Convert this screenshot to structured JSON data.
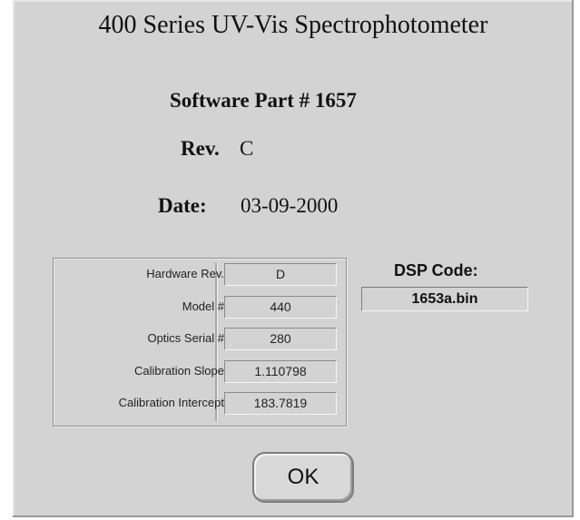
{
  "dialog": {
    "title": "400 Series UV-Vis Spectrophotometer",
    "software_part": "Software Part # 1657",
    "rev_label": "Rev.",
    "rev_value": "C",
    "date_label": "Date:",
    "date_value": "03-09-2000"
  },
  "hardware": {
    "rows": [
      {
        "label": "Hardware Rev.",
        "value": "D"
      },
      {
        "label": "Model #",
        "value": "440"
      },
      {
        "label": "Optics Serial #",
        "value": "280"
      },
      {
        "label": "Calibration Slope",
        "value": "1.110798"
      },
      {
        "label": "Calibration Intercept",
        "value": "183.7819"
      }
    ]
  },
  "dsp": {
    "label": "DSP Code:",
    "value": "1653a.bin"
  },
  "buttons": {
    "ok_label": "OK"
  }
}
